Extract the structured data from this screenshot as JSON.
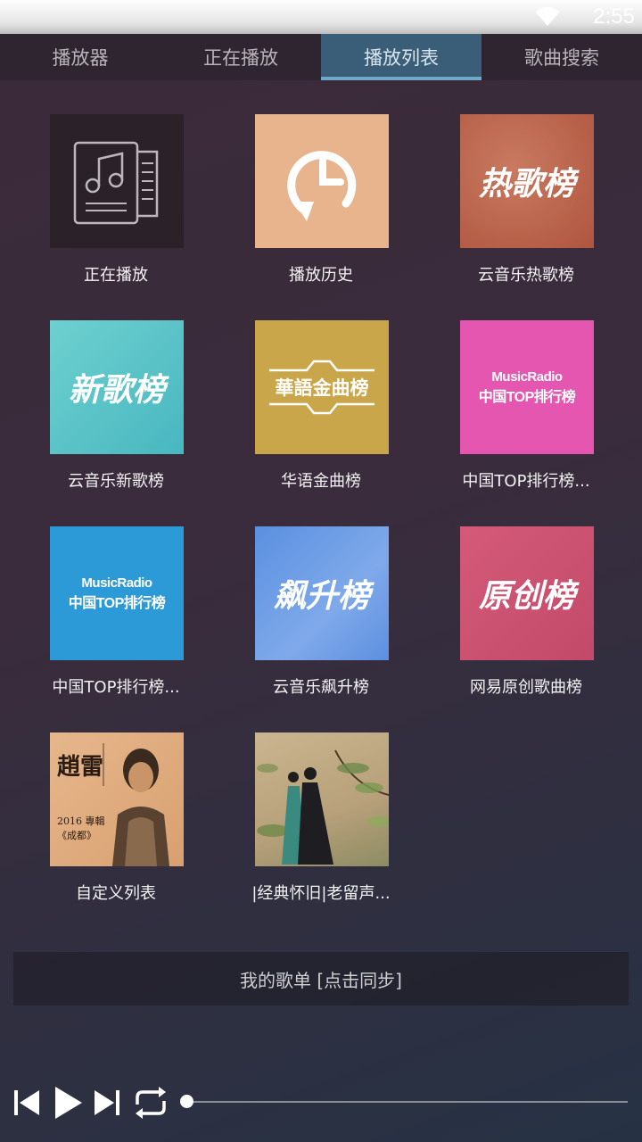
{
  "status_bar": {
    "time": "2:55"
  },
  "tabs": [
    {
      "label": "播放器"
    },
    {
      "label": "正在播放"
    },
    {
      "label": "播放列表",
      "active": true
    },
    {
      "label": "歌曲搜索"
    }
  ],
  "playlists": [
    {
      "title": "正在播放",
      "cover": "now-playing-document-icon"
    },
    {
      "title": "播放历史",
      "cover": "history-clock-icon"
    },
    {
      "title": "云音乐热歌榜",
      "cover_text": "热歌榜"
    },
    {
      "title": "云音乐新歌榜",
      "cover_text": "新歌榜"
    },
    {
      "title": "华语金曲榜",
      "cover_text": "華語金曲榜"
    },
    {
      "title": "中国TOP排行榜...",
      "cover_line1": "MusicRadio",
      "cover_line2": "中国TOP排行榜"
    },
    {
      "title": "中国TOP排行榜...",
      "cover_line1": "MusicRadio",
      "cover_line2": "中国TOP排行榜"
    },
    {
      "title": "云音乐飙升榜",
      "cover_text": "飙升榜"
    },
    {
      "title": "网易原创歌曲榜",
      "cover_text": "原创榜"
    },
    {
      "title": "自定义列表",
      "cover_text": "趙雷",
      "cover_sub": "2016 專輯 《成都》"
    },
    {
      "title": "|经典怀旧|老留声...",
      "cover": "vintage-couple-painting"
    }
  ],
  "sync_bar": {
    "label": "我的歌单 [点击同步]"
  },
  "player": {
    "progress": 0,
    "icons": [
      "previous-icon",
      "play-icon",
      "next-icon",
      "repeat-icon"
    ]
  },
  "colors": {
    "accent_tab": "#3a5d78",
    "accent_line": "#6fa9c9",
    "hot_cover": "#b85e48",
    "new_cover": "#4fbcc0",
    "gold_cover": "#c9a64a",
    "pink_cover": "#e456b0",
    "blue_cover": "#2d9ad8",
    "rising_cover": "#6d99e0",
    "original_cover": "#c94f6e"
  }
}
